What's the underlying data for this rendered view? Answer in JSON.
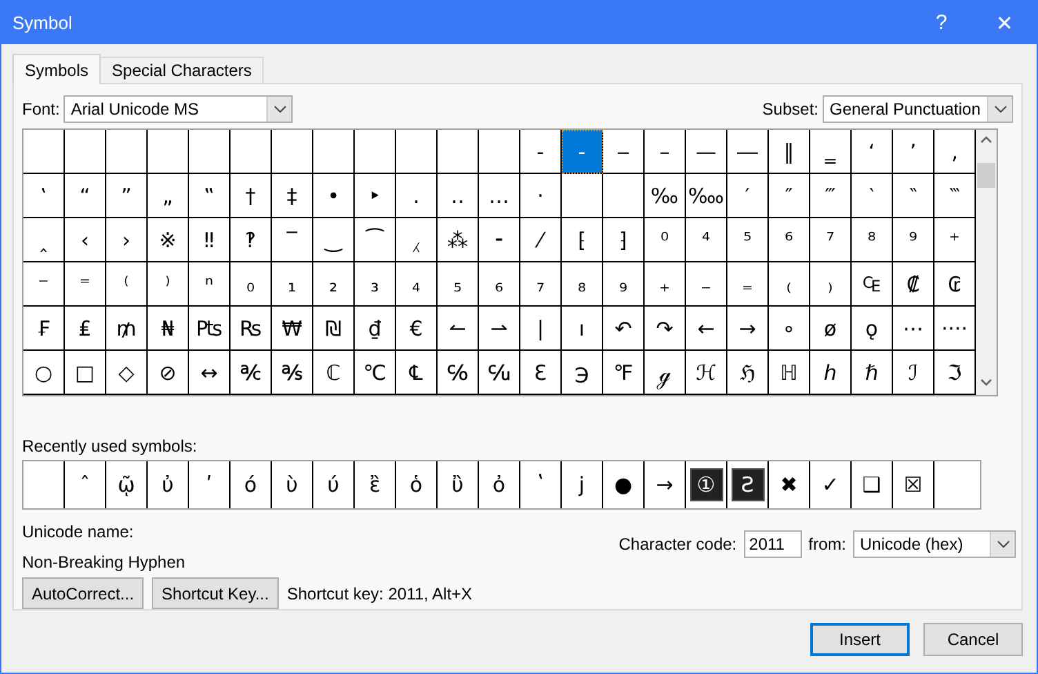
{
  "window": {
    "title": "Symbol",
    "help": "?",
    "close": "✕"
  },
  "tabs": [
    {
      "label": "Symbols",
      "selected": true
    },
    {
      "label": "Special Characters",
      "selected": false
    }
  ],
  "font": {
    "label": "Font:",
    "value": "Arial Unicode MS"
  },
  "subset": {
    "label": "Subset:",
    "value": "General Punctuation"
  },
  "grid": {
    "rows": [
      [
        {
          "kind": "blank",
          "selected": false
        },
        {
          "kind": "blank",
          "selected": false
        },
        {
          "kind": "blank",
          "selected": false
        },
        {
          "kind": "blank",
          "selected": false
        },
        {
          "kind": "blank",
          "selected": false
        },
        {
          "kind": "blank",
          "selected": false
        },
        {
          "kind": "blank",
          "selected": false
        },
        {
          "kind": "blank",
          "selected": false
        },
        {
          "kind": "blank",
          "selected": false
        },
        {
          "kind": "blank",
          "selected": false
        },
        {
          "kind": "blank",
          "selected": false
        },
        {
          "kind": "blank",
          "selected": false
        },
        {
          "kind": "glyph",
          "char": "‐",
          "selected": false
        },
        {
          "kind": "glyph",
          "char": "‑",
          "selected": true
        },
        {
          "kind": "glyph",
          "char": "‒",
          "selected": false
        },
        {
          "kind": "glyph",
          "char": "–",
          "selected": false
        },
        {
          "kind": "glyph",
          "char": "—",
          "selected": false
        },
        {
          "kind": "glyph",
          "char": "―",
          "selected": false
        },
        {
          "kind": "glyph",
          "char": "‖",
          "selected": false
        },
        {
          "kind": "glyph",
          "char": "‗",
          "selected": false
        },
        {
          "kind": "glyph",
          "char": "‘",
          "selected": false
        },
        {
          "kind": "glyph",
          "char": "’",
          "selected": false
        },
        {
          "kind": "glyph",
          "char": "‚",
          "selected": false
        }
      ],
      [
        {
          "kind": "glyph",
          "char": "‛",
          "selected": false
        },
        {
          "kind": "glyph",
          "char": "“",
          "selected": false
        },
        {
          "kind": "glyph",
          "char": "”",
          "selected": false
        },
        {
          "kind": "glyph",
          "char": "„",
          "selected": false
        },
        {
          "kind": "glyph",
          "char": "‟",
          "selected": false
        },
        {
          "kind": "glyph",
          "char": "†",
          "selected": false
        },
        {
          "kind": "glyph",
          "char": "‡",
          "selected": false
        },
        {
          "kind": "glyph",
          "char": "•",
          "selected": false
        },
        {
          "kind": "glyph",
          "char": "‣",
          "selected": false
        },
        {
          "kind": "glyph",
          "char": "․",
          "selected": false
        },
        {
          "kind": "glyph",
          "char": "‥",
          "selected": false
        },
        {
          "kind": "glyph",
          "char": "…",
          "selected": false
        },
        {
          "kind": "glyph",
          "char": "‧",
          "selected": false
        },
        {
          "kind": "blank",
          "selected": false
        },
        {
          "kind": "blank",
          "selected": false
        },
        {
          "kind": "glyph",
          "char": "‰",
          "selected": false
        },
        {
          "kind": "glyph",
          "char": "‱",
          "selected": false
        },
        {
          "kind": "glyph",
          "char": "′",
          "selected": false
        },
        {
          "kind": "glyph",
          "char": "″",
          "selected": false
        },
        {
          "kind": "glyph",
          "char": "‴",
          "selected": false
        },
        {
          "kind": "glyph",
          "char": "‵",
          "selected": false
        },
        {
          "kind": "glyph",
          "char": "‶",
          "selected": false
        },
        {
          "kind": "glyph",
          "char": "‷",
          "selected": false
        }
      ],
      [
        {
          "kind": "glyph",
          "char": "‸",
          "selected": false
        },
        {
          "kind": "glyph",
          "char": "‹",
          "selected": false
        },
        {
          "kind": "glyph",
          "char": "›",
          "selected": false
        },
        {
          "kind": "glyph",
          "char": "※",
          "selected": false
        },
        {
          "kind": "glyph",
          "char": "‼",
          "selected": false
        },
        {
          "kind": "glyph",
          "char": "‽",
          "selected": false
        },
        {
          "kind": "glyph",
          "char": "‾",
          "selected": false
        },
        {
          "kind": "glyph",
          "char": "‿",
          "selected": false
        },
        {
          "kind": "glyph",
          "char": "⁀",
          "selected": false
        },
        {
          "kind": "glyph",
          "char": "⁁",
          "selected": false
        },
        {
          "kind": "glyph",
          "char": "⁂",
          "selected": false
        },
        {
          "kind": "glyph",
          "char": "⁃",
          "selected": false
        },
        {
          "kind": "glyph",
          "char": "⁄",
          "selected": false
        },
        {
          "kind": "glyph",
          "char": "⁅",
          "selected": false
        },
        {
          "kind": "glyph",
          "char": "⁆",
          "selected": false
        },
        {
          "kind": "glyph",
          "char": "⁰",
          "selected": false
        },
        {
          "kind": "glyph",
          "char": "⁴",
          "selected": false
        },
        {
          "kind": "glyph",
          "char": "⁵",
          "selected": false
        },
        {
          "kind": "glyph",
          "char": "⁶",
          "selected": false
        },
        {
          "kind": "glyph",
          "char": "⁷",
          "selected": false
        },
        {
          "kind": "glyph",
          "char": "⁸",
          "selected": false
        },
        {
          "kind": "glyph",
          "char": "⁹",
          "selected": false
        },
        {
          "kind": "glyph",
          "char": "⁺",
          "selected": false
        }
      ],
      [
        {
          "kind": "glyph",
          "char": "⁻",
          "selected": false
        },
        {
          "kind": "glyph",
          "char": "⁼",
          "selected": false
        },
        {
          "kind": "glyph",
          "char": "⁽",
          "selected": false
        },
        {
          "kind": "glyph",
          "char": "⁾",
          "selected": false
        },
        {
          "kind": "glyph",
          "char": "ⁿ",
          "selected": false
        },
        {
          "kind": "glyph",
          "char": "₀",
          "selected": false
        },
        {
          "kind": "glyph",
          "char": "₁",
          "selected": false
        },
        {
          "kind": "glyph",
          "char": "₂",
          "selected": false
        },
        {
          "kind": "glyph",
          "char": "₃",
          "selected": false
        },
        {
          "kind": "glyph",
          "char": "₄",
          "selected": false
        },
        {
          "kind": "glyph",
          "char": "₅",
          "selected": false
        },
        {
          "kind": "glyph",
          "char": "₆",
          "selected": false
        },
        {
          "kind": "glyph",
          "char": "₇",
          "selected": false
        },
        {
          "kind": "glyph",
          "char": "₈",
          "selected": false
        },
        {
          "kind": "glyph",
          "char": "₉",
          "selected": false
        },
        {
          "kind": "glyph",
          "char": "₊",
          "selected": false
        },
        {
          "kind": "glyph",
          "char": "₋",
          "selected": false
        },
        {
          "kind": "glyph",
          "char": "₌",
          "selected": false
        },
        {
          "kind": "glyph",
          "char": "₍",
          "selected": false
        },
        {
          "kind": "glyph",
          "char": "₎",
          "selected": false
        },
        {
          "kind": "glyph",
          "char": "₠",
          "selected": false
        },
        {
          "kind": "glyph",
          "char": "₡",
          "selected": false
        },
        {
          "kind": "glyph",
          "char": "₢",
          "selected": false
        }
      ],
      [
        {
          "kind": "glyph",
          "char": "₣",
          "selected": false
        },
        {
          "kind": "glyph",
          "char": "₤",
          "selected": false
        },
        {
          "kind": "glyph",
          "char": "₥",
          "selected": false
        },
        {
          "kind": "glyph",
          "char": "₦",
          "selected": false
        },
        {
          "kind": "glyph",
          "char": "₧",
          "selected": false
        },
        {
          "kind": "glyph",
          "char": "₨",
          "selected": false
        },
        {
          "kind": "glyph",
          "char": "₩",
          "selected": false
        },
        {
          "kind": "glyph",
          "char": "₪",
          "selected": false
        },
        {
          "kind": "glyph",
          "char": "₫",
          "selected": false
        },
        {
          "kind": "glyph",
          "char": "€",
          "selected": false
        },
        {
          "kind": "glyph",
          "char": "↼",
          "selected": false
        },
        {
          "kind": "glyph",
          "char": "⇀",
          "selected": false
        },
        {
          "kind": "glyph",
          "char": "|",
          "selected": false
        },
        {
          "kind": "glyph",
          "char": "ı",
          "selected": false
        },
        {
          "kind": "glyph",
          "char": "↶",
          "selected": false
        },
        {
          "kind": "glyph",
          "char": "↷",
          "selected": false
        },
        {
          "kind": "glyph",
          "char": "←",
          "selected": false
        },
        {
          "kind": "glyph",
          "char": "→",
          "selected": false
        },
        {
          "kind": "glyph",
          "char": "∘",
          "selected": false
        },
        {
          "kind": "glyph",
          "char": "ø",
          "selected": false
        },
        {
          "kind": "glyph",
          "char": "ǫ",
          "selected": false
        },
        {
          "kind": "glyph",
          "char": "⋯",
          "selected": false
        },
        {
          "kind": "glyph",
          "char": "····",
          "selected": false
        }
      ],
      [
        {
          "kind": "glyph",
          "char": "○",
          "selected": false
        },
        {
          "kind": "glyph",
          "char": "□",
          "selected": false
        },
        {
          "kind": "glyph",
          "char": "◇",
          "selected": false
        },
        {
          "kind": "glyph",
          "char": "⊘",
          "selected": false
        },
        {
          "kind": "glyph",
          "char": "↔",
          "selected": false
        },
        {
          "kind": "glyph",
          "char": "℀",
          "selected": false
        },
        {
          "kind": "glyph",
          "char": "℁",
          "selected": false
        },
        {
          "kind": "glyph",
          "char": "ℂ",
          "selected": false
        },
        {
          "kind": "glyph",
          "char": "℃",
          "selected": false
        },
        {
          "kind": "glyph",
          "char": "℄",
          "selected": false
        },
        {
          "kind": "glyph",
          "char": "℅",
          "selected": false
        },
        {
          "kind": "glyph",
          "char": "℆",
          "selected": false
        },
        {
          "kind": "glyph",
          "char": "ℇ",
          "selected": false
        },
        {
          "kind": "glyph",
          "char": "℈",
          "selected": false
        },
        {
          "kind": "glyph",
          "char": "℉",
          "selected": false
        },
        {
          "kind": "glyph",
          "char": "ℊ",
          "selected": false
        },
        {
          "kind": "glyph",
          "char": "ℋ",
          "selected": false
        },
        {
          "kind": "glyph",
          "char": "ℌ",
          "selected": false
        },
        {
          "kind": "glyph",
          "char": "ℍ",
          "selected": false
        },
        {
          "kind": "glyph",
          "char": "ℎ",
          "selected": false
        },
        {
          "kind": "glyph",
          "char": "ℏ",
          "selected": false
        },
        {
          "kind": "glyph",
          "char": "ℐ",
          "selected": false
        },
        {
          "kind": "glyph",
          "char": "ℑ",
          "selected": false
        }
      ]
    ]
  },
  "recent": {
    "label": "Recently used symbols:",
    "cells": [
      {
        "kind": "blank"
      },
      {
        "kind": "glyph",
        "char": "ˆ"
      },
      {
        "kind": "glyph",
        "char": "ῷ"
      },
      {
        "kind": "glyph",
        "char": "ὐ"
      },
      {
        "kind": "glyph",
        "char": "ʹ"
      },
      {
        "kind": "glyph",
        "char": "ó"
      },
      {
        "kind": "glyph",
        "char": "ὺ"
      },
      {
        "kind": "glyph",
        "char": "ύ"
      },
      {
        "kind": "glyph",
        "char": "ἒ"
      },
      {
        "kind": "glyph",
        "char": "ὁ"
      },
      {
        "kind": "glyph",
        "char": "ὒ"
      },
      {
        "kind": "glyph",
        "char": "ὀ"
      },
      {
        "kind": "glyph",
        "char": "ʽ"
      },
      {
        "kind": "glyph",
        "char": "j"
      },
      {
        "kind": "glyph",
        "char": "●"
      },
      {
        "kind": "glyph",
        "char": "→"
      },
      {
        "kind": "badge",
        "char": "①"
      },
      {
        "kind": "badge",
        "char": "Ƨ"
      },
      {
        "kind": "glyph",
        "char": "✖"
      },
      {
        "kind": "glyph",
        "char": "✓"
      },
      {
        "kind": "glyph",
        "char": "❑"
      },
      {
        "kind": "glyph",
        "char": "☒"
      },
      {
        "kind": "blank"
      }
    ]
  },
  "unicode_name": {
    "label": "Unicode name:",
    "value": "Non-Breaking Hyphen"
  },
  "character_code": {
    "label": "Character code:",
    "value": "2011",
    "from_label": "from:",
    "from_value": "Unicode (hex)"
  },
  "buttons": [
    "AutoCorrect...",
    "Shortcut Key..."
  ],
  "shortcut_text": "Shortcut key: 2011, Alt+X",
  "footer_buttons": [
    {
      "label": "Insert",
      "kind": "default"
    },
    {
      "label": "Cancel",
      "kind": "normal"
    }
  ]
}
